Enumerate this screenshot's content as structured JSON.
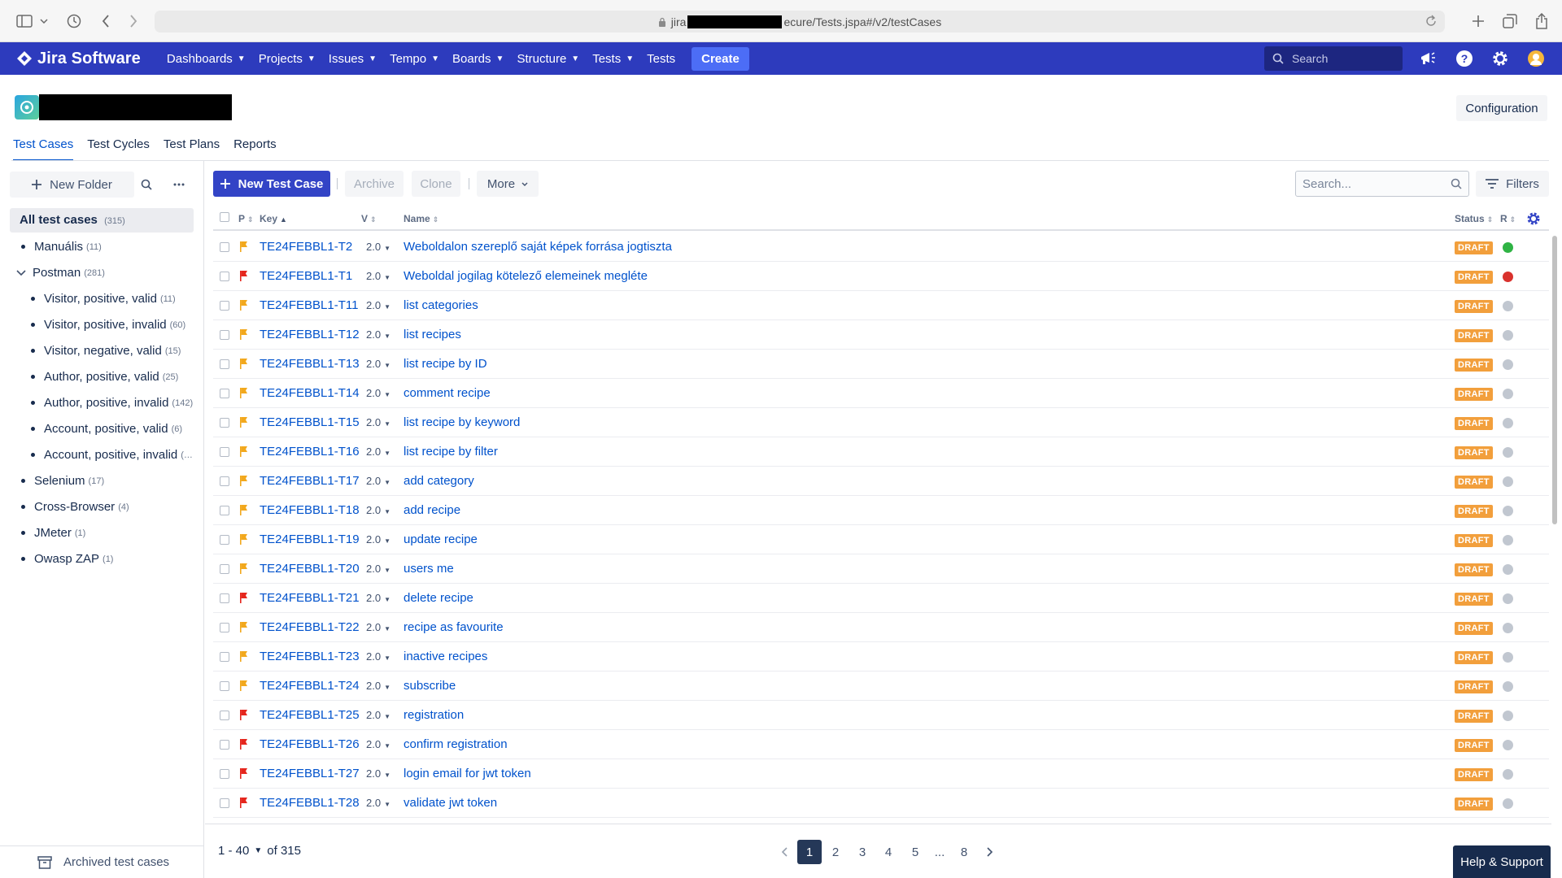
{
  "browser": {
    "url_prefix": "jira",
    "url_suffix": "ecure/Tests.jspa#/v2/testCases"
  },
  "nav": {
    "product": "Jira Software",
    "items": [
      "Dashboards",
      "Projects",
      "Issues",
      "Tempo",
      "Boards",
      "Structure",
      "Tests"
    ],
    "tests_link": "Tests",
    "create": "Create",
    "search_placeholder": "Search"
  },
  "project": {
    "configuration": "Configuration"
  },
  "tabs": [
    "Test Cases",
    "Test Cycles",
    "Test Plans",
    "Reports"
  ],
  "folders": {
    "new_folder": "New Folder",
    "root": {
      "label": "All test cases",
      "count": "(315)"
    },
    "items": [
      {
        "label": "Manuális",
        "count": "(11)"
      },
      {
        "label": "Postman",
        "count": "(281)",
        "expanded": true
      },
      {
        "label": "Visitor, positive, valid",
        "count": "(11)"
      },
      {
        "label": "Visitor, positive, invalid",
        "count": "(60)"
      },
      {
        "label": "Visitor, negative, valid",
        "count": "(15)"
      },
      {
        "label": "Author, positive, valid",
        "count": "(25)"
      },
      {
        "label": "Author, positive, invalid",
        "count": "(142)"
      },
      {
        "label": "Account, positive, valid",
        "count": "(6)"
      },
      {
        "label": "Account, positive, invalid",
        "count": "(…"
      },
      {
        "label": "Selenium",
        "count": "(17)"
      },
      {
        "label": "Cross-Browser",
        "count": "(4)"
      },
      {
        "label": "JMeter",
        "count": "(1)"
      },
      {
        "label": "Owasp ZAP",
        "count": "(1)"
      }
    ],
    "archived": "Archived test cases"
  },
  "toolbar": {
    "new_test_case": "New Test Case",
    "archive": "Archive",
    "clone": "Clone",
    "more": "More",
    "search_placeholder": "Search...",
    "filters": "Filters"
  },
  "table": {
    "headers": {
      "priority": "P",
      "key": "Key",
      "version": "V",
      "name": "Name",
      "status": "Status",
      "result": "R"
    },
    "status_colors": {
      "draft": "#f29f3c",
      "pass": "#2fb344",
      "fail": "#d9322d",
      "none": "#c1c7d0"
    },
    "flag_colors": {
      "normal": "#f2a81d",
      "high": "#e5261d"
    },
    "rows": [
      {
        "key": "TE24FEBBL1-T2",
        "version": "2.0",
        "name": "Weboldalon szereplő saját képek forrása jogtiszta",
        "status": "DRAFT",
        "priority": "normal",
        "result": "pass"
      },
      {
        "key": "TE24FEBBL1-T1",
        "version": "2.0",
        "name": "Weboldal jogilag kötelező elemeinek megléte",
        "status": "DRAFT",
        "priority": "high",
        "result": "fail"
      },
      {
        "key": "TE24FEBBL1-T11",
        "version": "2.0",
        "name": "list categories",
        "status": "DRAFT",
        "priority": "normal",
        "result": "none"
      },
      {
        "key": "TE24FEBBL1-T12",
        "version": "2.0",
        "name": "list recipes",
        "status": "DRAFT",
        "priority": "normal",
        "result": "none"
      },
      {
        "key": "TE24FEBBL1-T13",
        "version": "2.0",
        "name": "list recipe by ID",
        "status": "DRAFT",
        "priority": "normal",
        "result": "none"
      },
      {
        "key": "TE24FEBBL1-T14",
        "version": "2.0",
        "name": "comment recipe",
        "status": "DRAFT",
        "priority": "normal",
        "result": "none"
      },
      {
        "key": "TE24FEBBL1-T15",
        "version": "2.0",
        "name": "list recipe by keyword",
        "status": "DRAFT",
        "priority": "normal",
        "result": "none"
      },
      {
        "key": "TE24FEBBL1-T16",
        "version": "2.0",
        "name": "list recipe by filter",
        "status": "DRAFT",
        "priority": "normal",
        "result": "none"
      },
      {
        "key": "TE24FEBBL1-T17",
        "version": "2.0",
        "name": "add category",
        "status": "DRAFT",
        "priority": "normal",
        "result": "none"
      },
      {
        "key": "TE24FEBBL1-T18",
        "version": "2.0",
        "name": "add recipe",
        "status": "DRAFT",
        "priority": "normal",
        "result": "none"
      },
      {
        "key": "TE24FEBBL1-T19",
        "version": "2.0",
        "name": "update recipe",
        "status": "DRAFT",
        "priority": "normal",
        "result": "none"
      },
      {
        "key": "TE24FEBBL1-T20",
        "version": "2.0",
        "name": "users me",
        "status": "DRAFT",
        "priority": "normal",
        "result": "none"
      },
      {
        "key": "TE24FEBBL1-T21",
        "version": "2.0",
        "name": "delete recipe",
        "status": "DRAFT",
        "priority": "high",
        "result": "none"
      },
      {
        "key": "TE24FEBBL1-T22",
        "version": "2.0",
        "name": "recipe as favourite",
        "status": "DRAFT",
        "priority": "normal",
        "result": "none"
      },
      {
        "key": "TE24FEBBL1-T23",
        "version": "2.0",
        "name": "inactive recipes",
        "status": "DRAFT",
        "priority": "normal",
        "result": "none"
      },
      {
        "key": "TE24FEBBL1-T24",
        "version": "2.0",
        "name": "subscribe",
        "status": "DRAFT",
        "priority": "normal",
        "result": "none"
      },
      {
        "key": "TE24FEBBL1-T25",
        "version": "2.0",
        "name": "registration",
        "status": "DRAFT",
        "priority": "high",
        "result": "none"
      },
      {
        "key": "TE24FEBBL1-T26",
        "version": "2.0",
        "name": "confirm registration",
        "status": "DRAFT",
        "priority": "high",
        "result": "none"
      },
      {
        "key": "TE24FEBBL1-T27",
        "version": "2.0",
        "name": "login email for jwt token",
        "status": "DRAFT",
        "priority": "high",
        "result": "none"
      },
      {
        "key": "TE24FEBBL1-T28",
        "version": "2.0",
        "name": "validate jwt token",
        "status": "DRAFT",
        "priority": "high",
        "result": "none"
      }
    ]
  },
  "pagination": {
    "range": "1 - 40",
    "of": "of 315",
    "pages": [
      "1",
      "2",
      "3",
      "4",
      "5",
      "...",
      "8"
    ],
    "current": "1"
  },
  "help": "Help & Support"
}
